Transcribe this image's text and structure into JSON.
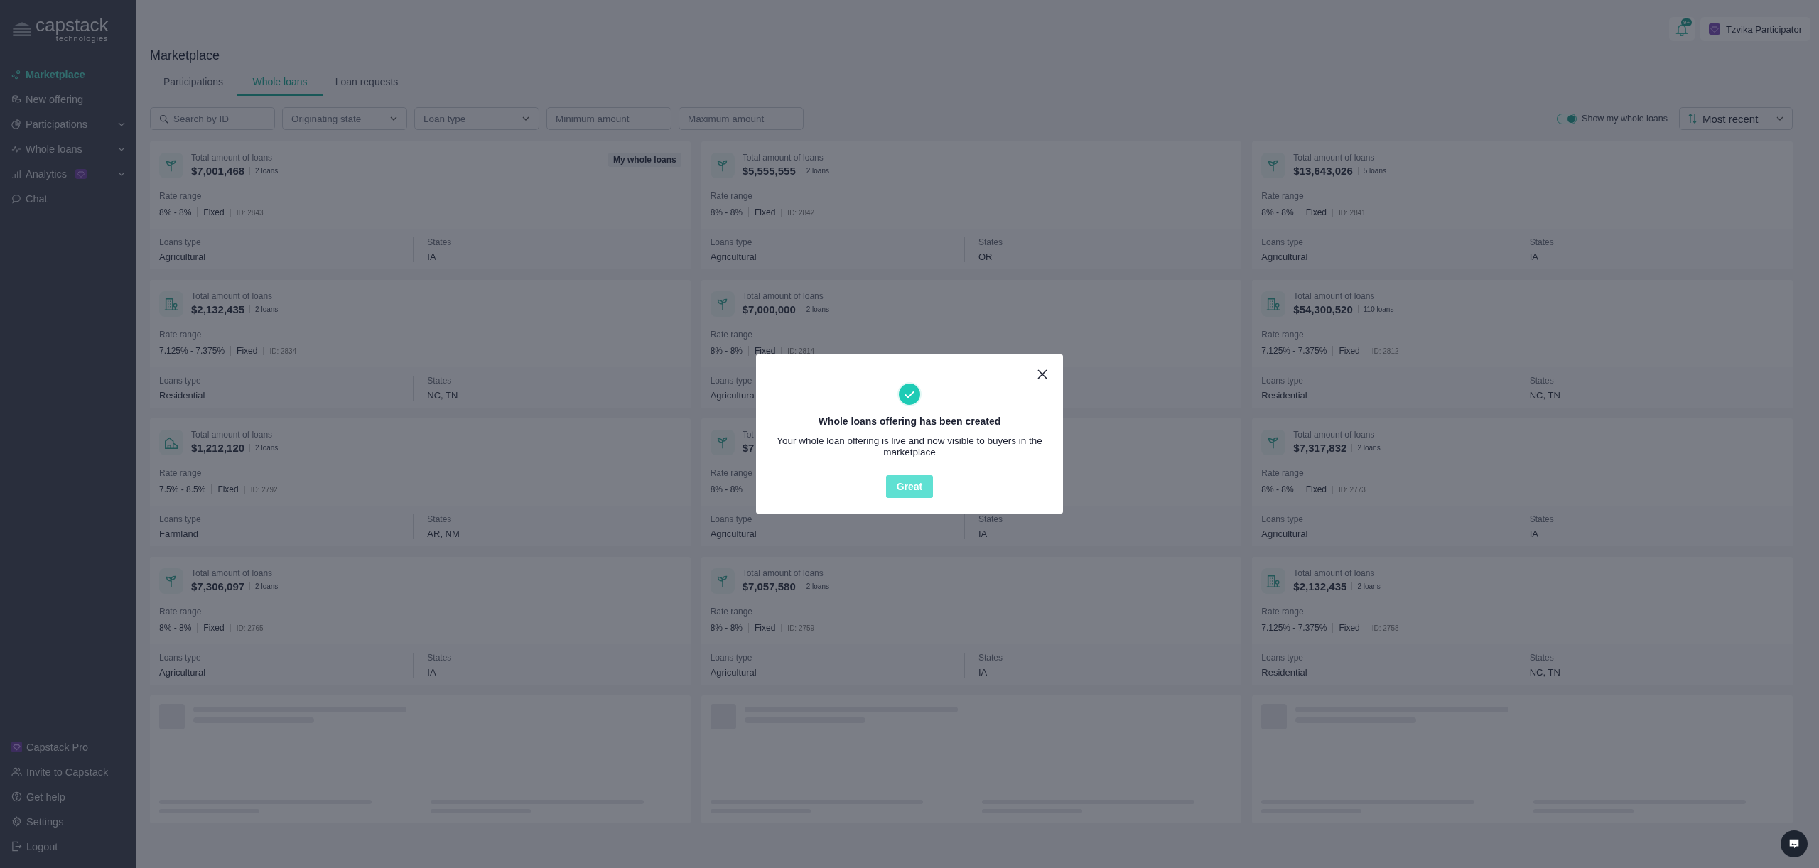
{
  "logo": {
    "name": "capstack",
    "tagline": "technologies"
  },
  "sidebar": {
    "items": [
      {
        "label": "Marketplace",
        "selected": true
      },
      {
        "label": "New offering",
        "selected": false
      },
      {
        "label": "Participations",
        "selected": false,
        "expandable": true
      },
      {
        "label": "Whole loans",
        "selected": false,
        "expandable": true
      },
      {
        "label": "Analytics",
        "selected": false,
        "expandable": true,
        "pro": true
      },
      {
        "label": "Chat",
        "selected": false
      }
    ],
    "footer": [
      {
        "label": "Capstack Pro"
      },
      {
        "label": "Invite to Capstack"
      },
      {
        "label": "Get help"
      },
      {
        "label": "Settings"
      },
      {
        "label": "Logout"
      }
    ]
  },
  "header": {
    "notifications": "9+",
    "user": "Tzvika Participator"
  },
  "page_title": "Marketplace",
  "tabs": [
    {
      "label": "Participations",
      "selected": false
    },
    {
      "label": "Whole loans",
      "selected": true
    },
    {
      "label": "Loan requests",
      "selected": false
    }
  ],
  "filters": [
    {
      "kind": "search",
      "placeholder": "Search by ID"
    },
    {
      "kind": "select",
      "placeholder": "Originating state"
    },
    {
      "kind": "select",
      "placeholder": "Loan type"
    },
    {
      "kind": "input",
      "placeholder": "Minimum amount"
    },
    {
      "kind": "input",
      "placeholder": "Maximum amount"
    }
  ],
  "toggle": {
    "label": "Show my whole loans",
    "on": true
  },
  "sort": {
    "value": "Most recent"
  },
  "cards": [
    {
      "kind": "sprout",
      "amount_label": "Total amount of loans",
      "amount": "$7,001,468",
      "count": "2 loans",
      "rate_label": "Rate range",
      "rate": "8% - 8%",
      "rate_type": "Fixed",
      "id": "ID: 2843",
      "type_label": "Loans type",
      "type": "Agricultural",
      "states_label": "States",
      "states": "IA",
      "badge": "My whole loans"
    },
    {
      "kind": "sprout",
      "amount_label": "Total amount of loans",
      "amount": "$5,555,555",
      "count": "2 loans",
      "rate_label": "Rate range",
      "rate": "8% - 8%",
      "rate_type": "Fixed",
      "id": "ID: 2842",
      "type_label": "Loans type",
      "type": "Agricultural",
      "states_label": "States",
      "states": "OR"
    },
    {
      "kind": "sprout",
      "amount_label": "Total amount of loans",
      "amount": "$13,643,026",
      "count": "5 loans",
      "rate_label": "Rate range",
      "rate": "8% - 8%",
      "rate_type": "Fixed",
      "id": "ID: 2841",
      "type_label": "Loans type",
      "type": "Agricultural",
      "states_label": "States",
      "states": "IA"
    },
    {
      "kind": "building",
      "amount_label": "Total amount of loans",
      "amount": "$2,132,435",
      "count": "2 loans",
      "rate_label": "Rate range",
      "rate": "7.125% - 7.375%",
      "rate_type": "Fixed",
      "id": "ID: 2834",
      "type_label": "Loans type",
      "type": "Residential",
      "states_label": "States",
      "states": "NC, TN"
    },
    {
      "kind": "sprout",
      "amount_label": "Total amount of loans",
      "amount": "$7,000,000",
      "count": "2 loans",
      "rate_label": "Rate range",
      "rate": "8% - 8%",
      "rate_type": "Fixed",
      "id": "ID: 2814",
      "type_label": "Loans type",
      "type": "Agricultura"
    },
    {
      "kind": "building",
      "amount_label": "Total amount of loans",
      "amount": "$54,300,520",
      "count": "110 loans",
      "rate_label": "Rate range",
      "rate": "7.125% - 7.375%",
      "rate_type": "Fixed",
      "id": "ID: 2812",
      "type_label": "Loans type",
      "type": "Residential",
      "states_label": "States",
      "states": "NC, TN"
    },
    {
      "kind": "barn",
      "amount_label": "Total amount of loans",
      "amount": "$1,212,120",
      "count": "2 loans",
      "rate_label": "Rate range",
      "rate": "7.5% - 8.5%",
      "rate_type": "Fixed",
      "id": "ID: 2792",
      "type_label": "Loans type",
      "type": "Farmland",
      "states_label": "States",
      "states": "AR, NM"
    },
    {
      "kind": "sprout",
      "amount_label": "Tot",
      "amount": "$7",
      "rate_label": "Rate range",
      "rate": "8% - 8%",
      "type_label": "Loans type",
      "type": "Agricultural",
      "states_label": "States",
      "states": "IA"
    },
    {
      "kind": "sprout",
      "amount_label": "Total amount of loans",
      "amount": "$7,317,832",
      "count": "2 loans",
      "rate_label": "Rate range",
      "rate": "8% - 8%",
      "rate_type": "Fixed",
      "id": "ID: 2773",
      "type_label": "Loans type",
      "type": "Agricultural",
      "states_label": "States",
      "states": "IA"
    },
    {
      "kind": "sprout",
      "amount_label": "Total amount of loans",
      "amount": "$7,306,097",
      "count": "2 loans",
      "rate_label": "Rate range",
      "rate": "8% - 8%",
      "rate_type": "Fixed",
      "id": "ID: 2765",
      "type_label": "Loans type",
      "type": "Agricultural",
      "states_label": "States",
      "states": "IA"
    },
    {
      "kind": "sprout",
      "amount_label": "Total amount of loans",
      "amount": "$7,057,580",
      "count": "2 loans",
      "rate_label": "Rate range",
      "rate": "8% - 8%",
      "rate_type": "Fixed",
      "id": "ID: 2759",
      "type_label": "Loans type",
      "type": "Agricultural",
      "states_label": "States",
      "states": "IA"
    },
    {
      "kind": "building",
      "amount_label": "Total amount of loans",
      "amount": "$2,132,435",
      "count": "2 loans",
      "rate_label": "Rate range",
      "rate": "7.125% - 7.375%",
      "rate_type": "Fixed",
      "id": "ID: 2758",
      "type_label": "Loans type",
      "type": "Residential",
      "states_label": "States",
      "states": "NC, TN"
    }
  ],
  "placeholder_cards": [
    {
      "kind": "skeleton"
    },
    {
      "kind": "skeleton"
    },
    {
      "kind": "skeleton"
    }
  ],
  "modal": {
    "title": "Whole loans offering has been created",
    "message": "Your whole loan offering is live and now visible to buyers in the marketplace",
    "button": "Great"
  }
}
